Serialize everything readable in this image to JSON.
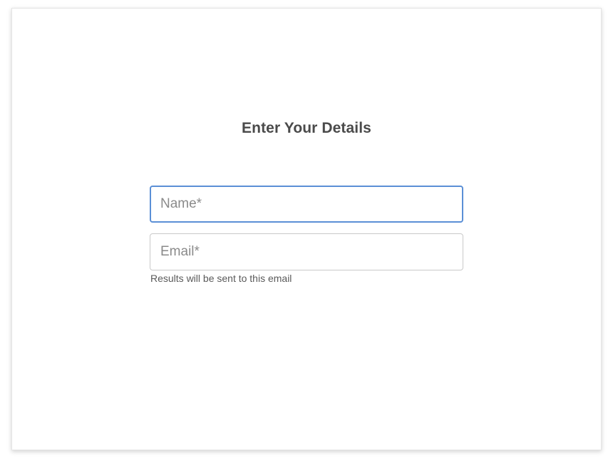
{
  "form": {
    "title": "Enter Your Details",
    "name_field": {
      "placeholder": "Name*",
      "value": ""
    },
    "email_field": {
      "placeholder": "Email*",
      "value": ""
    },
    "email_hint": "Results will be sent to this email"
  },
  "colors": {
    "focus_border": "#5b8fd6",
    "default_border": "#c9c9c9",
    "title_text": "#4a4a4a"
  }
}
